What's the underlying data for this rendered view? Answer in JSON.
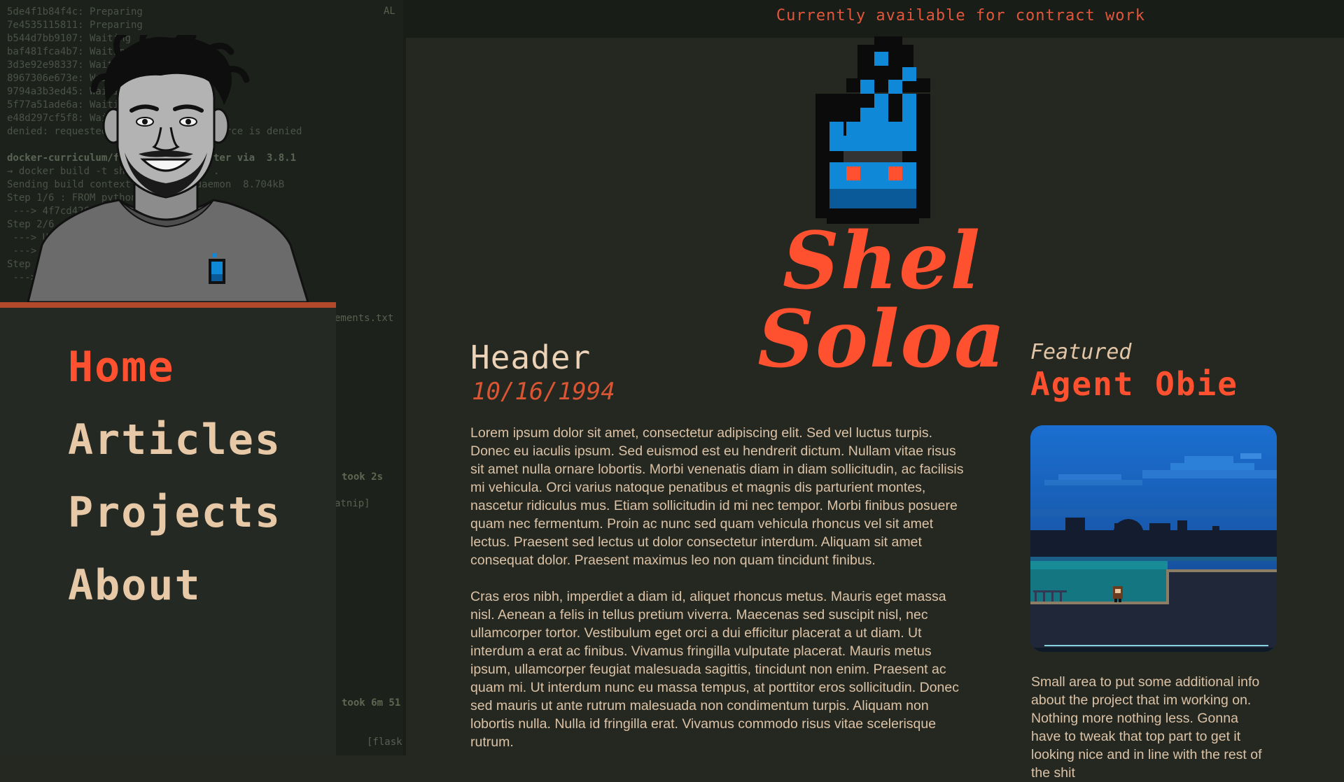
{
  "banner": {
    "text": "Currently available for contract work"
  },
  "terminal": {
    "lines": [
      "5de4f1b84f4c: Preparing",
      "7e4535115811: Preparing",
      "b544d7bb9107: Waiting",
      "baf481fca4b7: Waiting",
      "3d3e92e98337: Waiting",
      "8967306e673e: Waiting",
      "9794a3b3ed45: Waiting",
      "5f77a51ade6a: Waiting",
      "e48d297cf5f8: Waiting",
      "denied: requested access to the resource is denied",
      "",
      "docker-curriculum/flask-app on  master via  3.8.1",
      "→ docker build -t shelsoloa/catnip .",
      "Sending build context to Docker daemon  8.704kB",
      "Step 1/6 : FROM python:3",
      " ---> 4f7cd4269fa9",
      "Step 2/6 : WORKDIR /usr/src/app",
      " ---> Using cache",
      " ---> 1d2f6e1e3c0b",
      "Step 3/6 : COPY . .",
      " ---> a5c0e2d1f9a1"
    ],
    "snippets": [
      "ements.txt",
      "took 2s",
      "atnip]",
      "took 6m 51",
      "[flask"
    ],
    "corner": "AL"
  },
  "nav": {
    "items": [
      {
        "label": "Home",
        "active": true
      },
      {
        "label": "Articles",
        "active": false
      },
      {
        "label": "Projects",
        "active": false
      },
      {
        "label": "About",
        "active": false
      }
    ]
  },
  "site": {
    "name": "Shel Soloa"
  },
  "article": {
    "title": "Header",
    "date": "10/16/1994",
    "paragraphs": [
      "Lorem ipsum dolor sit amet, consectetur adipiscing elit. Sed vel luctus turpis. Donec eu iaculis ipsum. Sed euismod est eu hendrerit dictum. Nullam vitae risus sit amet nulla ornare lobortis. Morbi venenatis diam in diam sollicitudin, ac facilisis mi vehicula. Orci varius natoque penatibus et magnis dis parturient montes, nascetur ridiculus mus. Etiam sollicitudin id mi nec tempor. Morbi finibus posuere quam nec fermentum. Proin ac nunc sed quam vehicula rhoncus vel sit amet lectus. Praesent sed lectus ut dolor consectetur interdum. Aliquam sit amet consequat dolor. Praesent maximus leo non quam tincidunt finibus.",
      "Cras eros nibh, imperdiet a diam id, aliquet rhoncus metus. Mauris eget massa nisl. Aenean a felis in tellus pretium viverra. Maecenas sed suscipit nisl, nec ullamcorper tortor. Vestibulum eget orci a dui efficitur placerat a ut diam. Ut interdum a erat ac finibus. Vivamus fringilla vulputate placerat. Mauris metus ipsum, ullamcorper feugiat malesuada sagittis, tincidunt non enim. Praesent ac quam mi. Ut interdum nunc eu massa tempus, at porttitor eros sollicitudin. Donec sed mauris ut ante rutrum malesuada non condimentum turpis. Aliquam non lobortis nulla. Nulla id fringilla erat. Vivamus commodo risus vitae scelerisque rutrum."
    ]
  },
  "featured": {
    "label": "Featured",
    "title": "Agent Obie",
    "description": "Small area to put some additional info about the project that im working on. Nothing more nothing less. Gonna have to tweak that top part to get it looking nice and in line with the rest of the shit"
  },
  "colors": {
    "accent": "#ff5130",
    "text": "#dcc2a6",
    "background": "#242820",
    "panel": "#252924",
    "logo_blue": "#1088d8",
    "logo_dark_blue": "#0a5a9a"
  },
  "icons": {
    "logo": "blue-flame-logo-icon",
    "avatar": "person-avatar-illustration"
  }
}
